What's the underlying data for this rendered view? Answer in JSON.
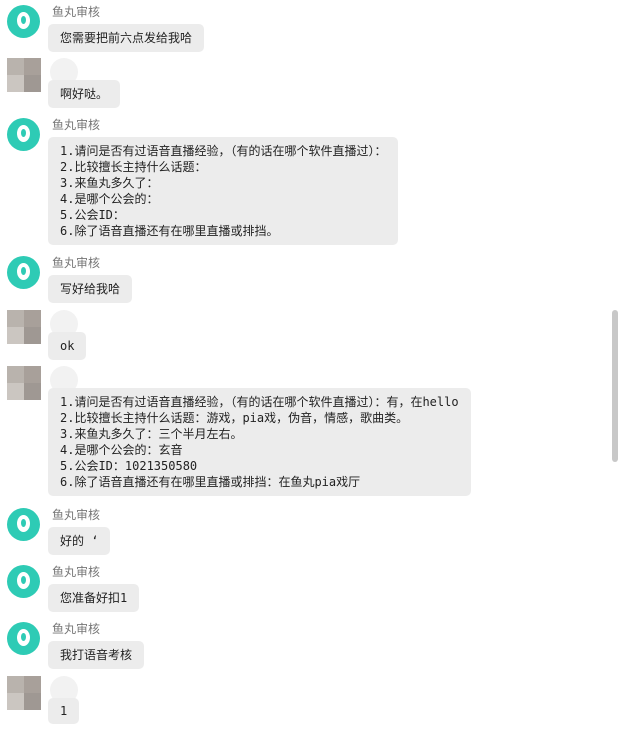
{
  "messages": [
    {
      "sender": "鱼丸审核",
      "lines": [
        "您需要把前六点发给我哈"
      ]
    },
    {
      "lines": [
        "啊好哒。"
      ]
    },
    {
      "sender": "鱼丸审核",
      "lines": [
        "1.请问是否有过语音直播经验，（有的话在哪个软件直播过）：",
        "2.比较擅长主持什么话题：",
        "3.来鱼丸多久了：",
        "4.是哪个公会的：",
        "5.公会ID：",
        "6.除了语音直播还有在哪里直播或排挡。"
      ]
    },
    {
      "sender": "鱼丸审核",
      "lines": [
        "写好给我哈"
      ]
    },
    {
      "lines": [
        "ok"
      ]
    },
    {
      "lines": [
        "1.请问是否有过语音直播经验，（有的话在哪个软件直播过）：有，在hello",
        "2.比较擅长主持什么话题：游戏，pia戏，伪音，情感，歌曲类。",
        "3.来鱼丸多久了：三个半月左右。",
        "4.是哪个公会的：玄音",
        "5.公会ID：1021350580",
        "6.除了语音直播还有在哪里直播或排挡：在鱼丸pia戏厅"
      ]
    },
    {
      "sender": "鱼丸审核",
      "lines": [
        "好的 ‘"
      ]
    },
    {
      "sender": "鱼丸审核",
      "lines": [
        "您准备好扣1"
      ]
    },
    {
      "sender": "鱼丸审核",
      "lines": [
        "我打语音考核"
      ]
    },
    {
      "lines": [
        "1"
      ]
    }
  ]
}
